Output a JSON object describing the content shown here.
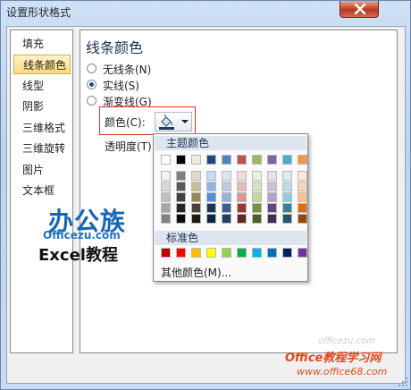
{
  "dialog": {
    "title": "设置形状格式",
    "close_icon": "close-icon"
  },
  "sidebar": {
    "items": [
      {
        "label": "填充",
        "selected": false
      },
      {
        "label": "线条颜色",
        "selected": true
      },
      {
        "label": "线型",
        "selected": false
      },
      {
        "label": "阴影",
        "selected": false
      },
      {
        "label": "三维格式",
        "selected": false
      },
      {
        "label": "三维旋转",
        "selected": false
      },
      {
        "label": "图片",
        "selected": false
      },
      {
        "label": "文本框",
        "selected": false
      }
    ]
  },
  "panel": {
    "title": "线条颜色",
    "options": [
      {
        "label": "无线条(N)",
        "selected": false
      },
      {
        "label": "实线(S)",
        "selected": true
      },
      {
        "label": "渐变线(G)",
        "selected": false
      }
    ],
    "color_label": "颜色(C):",
    "color_button_icon": "paint-bucket-icon",
    "transparency_label": "透明度(T):"
  },
  "color_popup": {
    "theme_header": "主题颜色",
    "standard_header": "标准色",
    "more_colors": "其他颜色(M)...",
    "theme_colors": [
      [
        "#ffffff",
        "#f2f2f2",
        "#d9d9d9",
        "#bfbfbf",
        "#a6a6a6",
        "#808080"
      ],
      [
        "#000000",
        "#7f7f7f",
        "#595959",
        "#404040",
        "#262626",
        "#0d0d0d"
      ],
      [
        "#eeece1",
        "#ddd9c3",
        "#c4bd97",
        "#948a54",
        "#4a452a",
        "#1d1b10"
      ],
      [
        "#1f497d",
        "#c6d9f0",
        "#8db3e2",
        "#548dd4",
        "#17365d",
        "#0f243e"
      ],
      [
        "#4f81bd",
        "#dbe5f1",
        "#b8cce4",
        "#95b3d7",
        "#366092",
        "#244061"
      ],
      [
        "#c0504d",
        "#f2dcdb",
        "#e5b9b7",
        "#d99694",
        "#953734",
        "#632423"
      ],
      [
        "#9bbb59",
        "#ebf1dd",
        "#d7e3bc",
        "#c3d69b",
        "#76923c",
        "#4f6128"
      ],
      [
        "#8064a2",
        "#e5e0ec",
        "#ccc1d9",
        "#b2a2c7",
        "#5f497a",
        "#3f3151"
      ],
      [
        "#4bacc6",
        "#dbeef3",
        "#b7dde8",
        "#92cddc",
        "#31859b",
        "#205867"
      ],
      [
        "#f79646",
        "#fdeada",
        "#fbd5b5",
        "#fac08f",
        "#e36c09",
        "#974806"
      ]
    ],
    "standard_colors": [
      "#c00000",
      "#ff0000",
      "#ffc000",
      "#ffff00",
      "#92d050",
      "#00b050",
      "#00b0f0",
      "#0070c0",
      "#002060",
      "#7030a0"
    ]
  },
  "watermark": {
    "brand_top": "办公族",
    "brand_url": "Officezu.com",
    "brand_sub": "Excel教程",
    "site_name": "Office教程学习网",
    "site_url": "www.office68.com",
    "logo_text": "officezu.com"
  }
}
